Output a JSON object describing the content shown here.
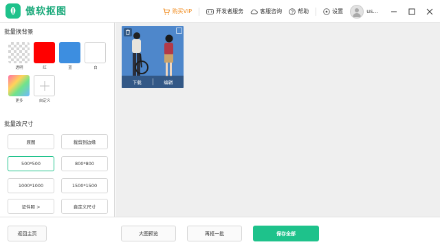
{
  "app": {
    "title": "傲软抠图"
  },
  "titlebar": {
    "vip_label": "购买VIP",
    "dev_label": "开发者服务",
    "support_label": "客服咨询",
    "help_label": "帮助",
    "settings_label": "设置",
    "username": "us...",
    "accent": "#1ec28b",
    "vip_color": "#f08a1c"
  },
  "sidebar": {
    "bg_section_title": "批量换背景",
    "backgrounds": [
      {
        "label": "透明",
        "color": "transparent"
      },
      {
        "label": "红",
        "color": "#ff0000"
      },
      {
        "label": "蓝",
        "color": "#3d8ee0"
      },
      {
        "label": "白",
        "color": "#ffffff"
      },
      {
        "label": "更多",
        "color": "gradient"
      },
      {
        "label": "自定义",
        "icon": "plus-icon"
      }
    ],
    "size_section_title": "批量改尺寸",
    "sizes": [
      {
        "label": "原图"
      },
      {
        "label": "裁剪到边缘"
      },
      {
        "label": "500*500",
        "active": true
      },
      {
        "label": "800*800"
      },
      {
        "label": "1000*1000"
      },
      {
        "label": "1500*1500"
      },
      {
        "label": "证件照 >"
      },
      {
        "label": "自定义尺寸"
      }
    ]
  },
  "canvas": {
    "thumbnail": {
      "download_label": "下载",
      "edit_label": "编辑"
    }
  },
  "footer": {
    "back_label": "返回主页",
    "preview_label": "大图预览",
    "another_label": "再抠一批",
    "save_all_label": "保存全部"
  }
}
